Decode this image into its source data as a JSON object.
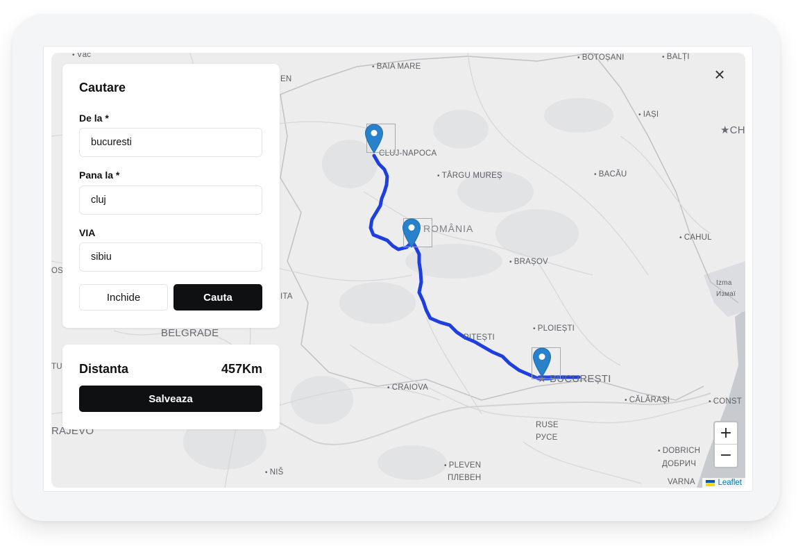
{
  "search_panel": {
    "title": "Cautare",
    "from_label": "De la *",
    "from_value": "bucuresti",
    "to_label": "Pana la *",
    "to_value": "cluj",
    "via_label": "VIA",
    "via_value": "sibiu",
    "close_label": "Inchide",
    "search_label": "Cauta"
  },
  "distance_panel": {
    "label": "Distanta",
    "value": "457Km",
    "save_label": "Salveaza"
  },
  "map": {
    "city_labels": {
      "baia_mare": "BAIA MARE",
      "botosani": "BOTOȘANI",
      "balti": "BALȚI",
      "iasi": "IAȘI",
      "chisinau": "CH",
      "cluj": "CLUJ-NAPOCA",
      "targu_mures": "TÂRGU MUREȘ",
      "bacau": "BACĂU",
      "romania": "ROMÂNIA",
      "cahul": "CAHUL",
      "brasov": "BRAȘOV",
      "ploiesti": "PLOIEȘTI",
      "pitesti": "PITEȘTI",
      "bucuresti": "BUCUREȘTI",
      "craiova": "CRAIOVA",
      "calarasi": "CĂLĂRAȘI",
      "constanta": "CONST",
      "ruse": "RUSE",
      "ruse_cyr": "РУСЕ",
      "dobrich": "DOBRICH",
      "dobrich_cyr": "ДОБРИЧ",
      "pleven": "PLEVEN",
      "pleven_cyr": "ПЛЕВЕН",
      "varna": "VARNA",
      "nis": "NIŠ",
      "belgrade": "BELGRADE",
      "sarajevo": "RAJEVO",
      "vac": "Vác",
      "izmail": "Izma",
      "izmail_cyr": "Измаї",
      "edge_en": "EN",
      "edge_ita": "ITA",
      "edge_tu": "TU",
      "edge_os": "OS"
    },
    "attribution": "Leaflet",
    "zoom_in": "+",
    "zoom_out": "−",
    "close_icon": "×",
    "markers": [
      "Cluj-Napoca",
      "Sibiu",
      "București"
    ],
    "route_color": "#1d3fe0",
    "marker_color": "#2a81cb"
  }
}
